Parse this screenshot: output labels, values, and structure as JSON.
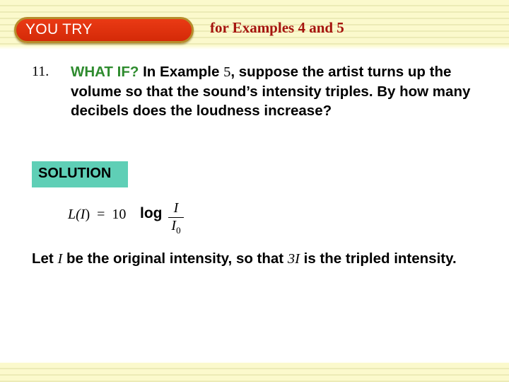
{
  "header": {
    "badge": "YOU TRY",
    "subtitle": "for Examples 4 and 5"
  },
  "problem": {
    "number": "11.",
    "label": "WHAT IF?",
    "text_before_num": "In Example",
    "example_num": "5",
    "text_after_num": ", suppose the artist turns up the volume so that the sound’s intensity triples. By how many decibels does the loudness increase?"
  },
  "solution": {
    "label": "SOLUTION",
    "formula": {
      "lhs_func": "L(",
      "lhs_var": "I",
      "lhs_close": ")",
      "equals": "=",
      "coef": "10",
      "op": "log",
      "numerator": "I",
      "denominator": "I",
      "denominator_sub": "0"
    },
    "explanation": {
      "part1": "Let",
      "var1": "I",
      "part2": "be the original intensity, so that",
      "var2": "3I",
      "part3": "is the tripled intensity."
    }
  },
  "colors": {
    "badge_red": "#e0320e",
    "subtitle_red": "#a5140e",
    "whatif_green": "#2e8b2e",
    "solution_teal": "#5fcfb6",
    "band_yellow": "#fbf9cc"
  }
}
